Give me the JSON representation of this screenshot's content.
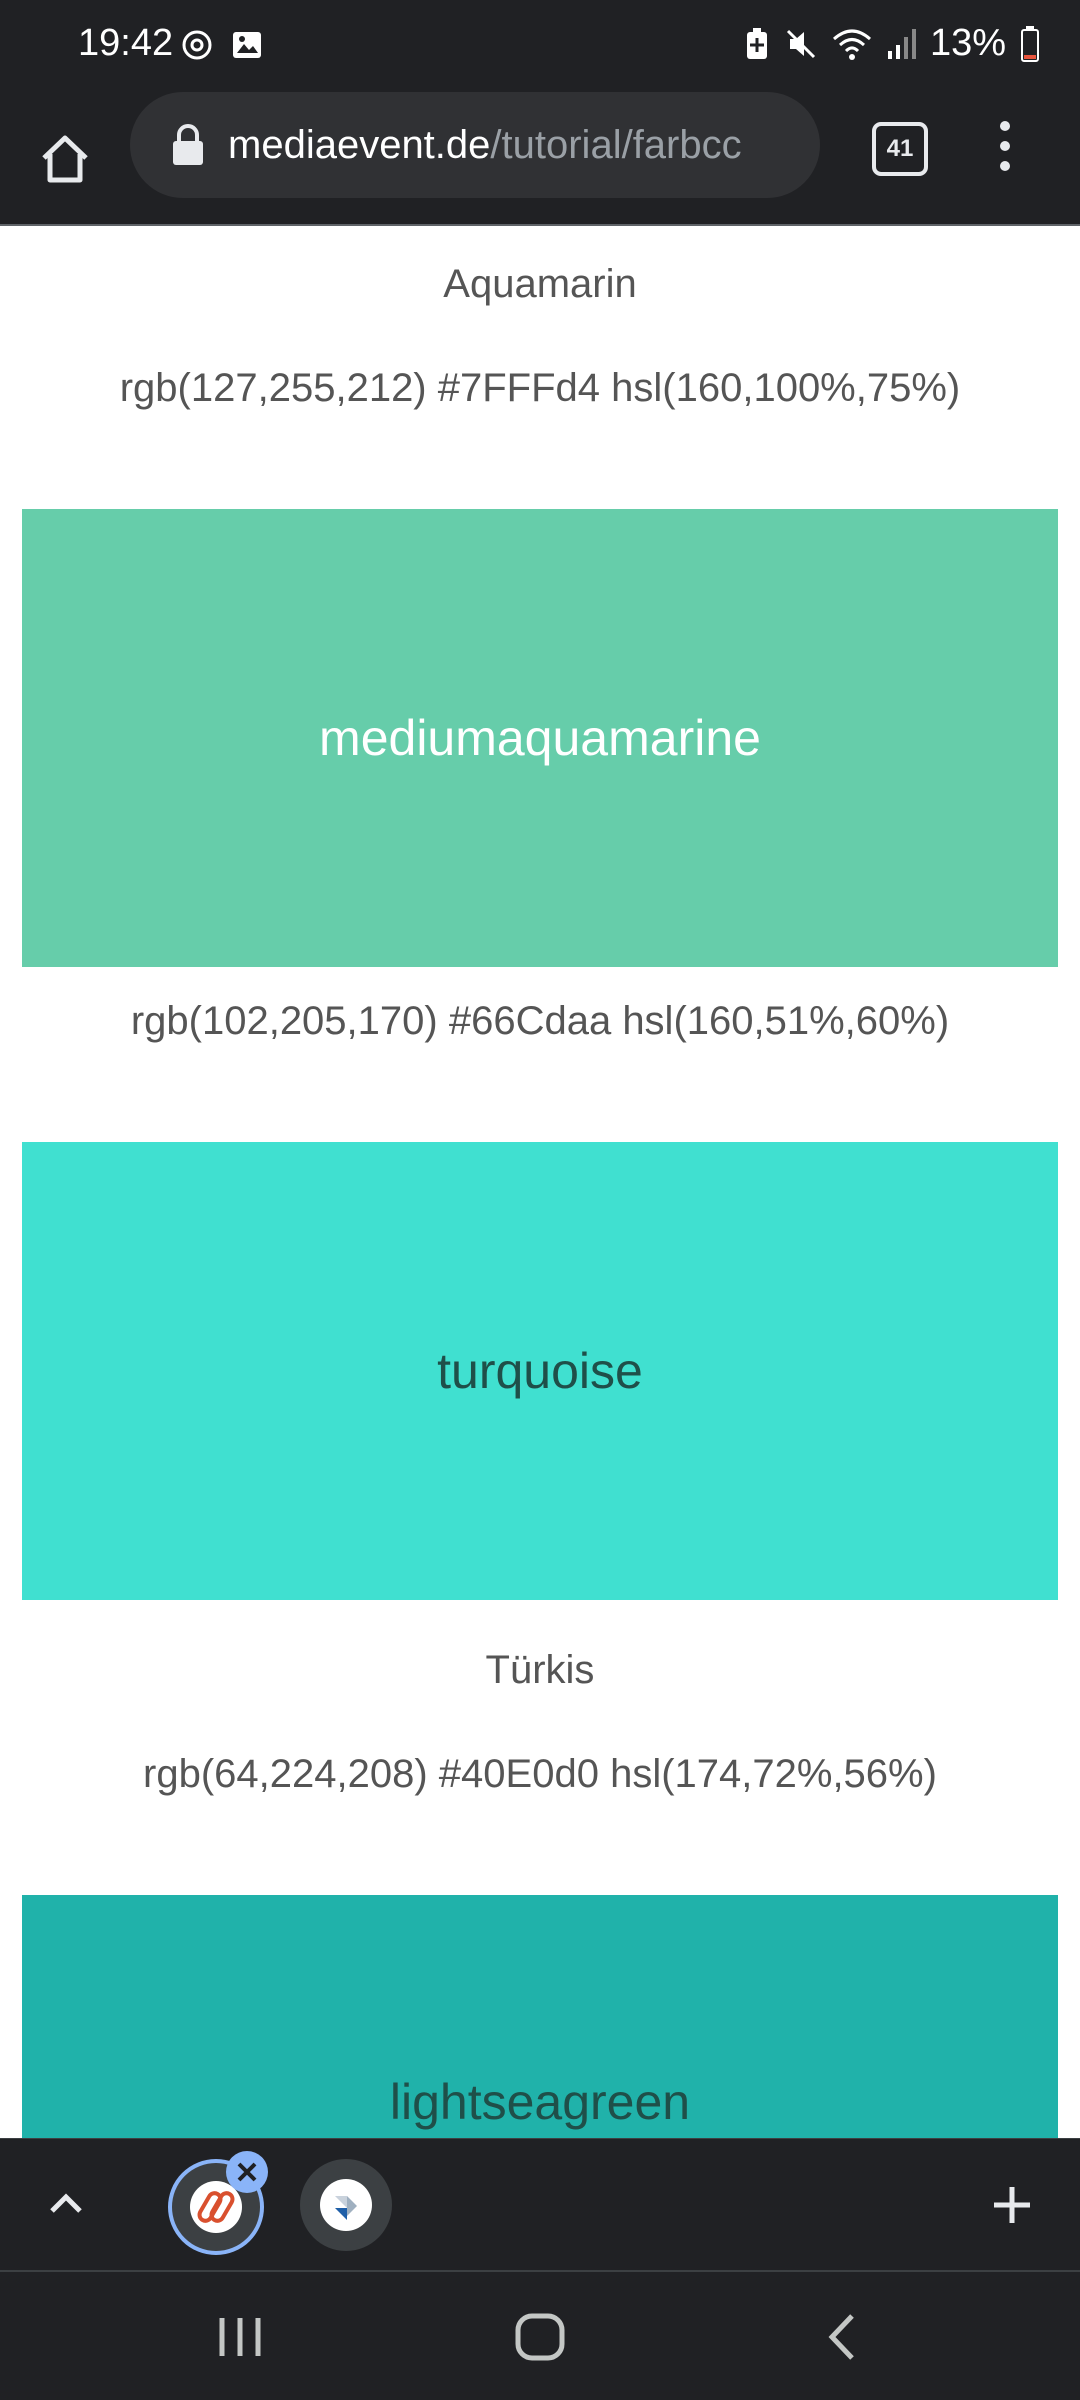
{
  "status_bar": {
    "time": "19:42",
    "battery": "13%",
    "icons": [
      "sync-icon",
      "image-icon",
      "battery-saver-icon",
      "mute-icon",
      "wifi-icon",
      "signal-icon",
      "battery-icon"
    ]
  },
  "browser": {
    "url_domain": "mediaevent.de",
    "url_path": "/tutorial/farbcc",
    "tab_count": "41"
  },
  "content": {
    "sections": [
      {
        "caption": "Aquamarin",
        "values": "rgb(127,255,212) #7FFFd4 hsl(160,100%,75%)"
      },
      {
        "name": "mediumaquamarine",
        "color": "#66CDAA",
        "text_color": "#ffffff",
        "values": "rgb(102,205,170) #66Cdaa hsl(160,51%,60%)"
      },
      {
        "name": "turquoise",
        "color": "#40E0D0",
        "text_color": "#1f4f49",
        "caption": "Türkis",
        "values": "rgb(64,224,208) #40E0d0 hsl(174,72%,56%)"
      },
      {
        "name": "lightseagreen",
        "color": "#20B2AA",
        "text_color": "#1f4f49"
      }
    ]
  },
  "bottom_bar": {
    "tabs": [
      "tab-1",
      "tab-2"
    ]
  }
}
